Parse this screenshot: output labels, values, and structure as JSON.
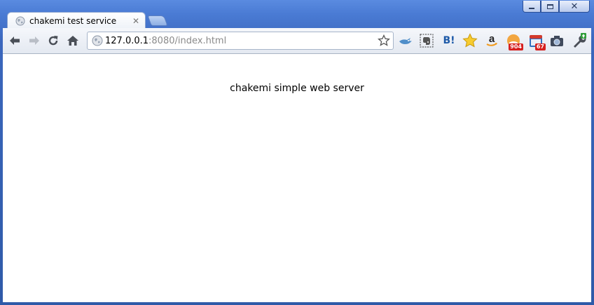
{
  "window": {
    "controls": [
      "minimize",
      "maximize",
      "close"
    ]
  },
  "tabs": [
    {
      "title": "chakemi test service",
      "icon": "globe-icon",
      "active": true
    }
  ],
  "toolbar": {
    "url_host": "127.0.0.1",
    "url_rest": ":8080/index.html",
    "extensions": [
      {
        "name": "bird-icon"
      },
      {
        "name": "evernote-icon"
      },
      {
        "name": "hatena-bookmark-icon",
        "label": "B!"
      },
      {
        "name": "star-bookmark-icon"
      },
      {
        "name": "amazon-icon",
        "label": "a"
      },
      {
        "name": "rss-icon",
        "badge": "904"
      },
      {
        "name": "calendar-icon",
        "badge": "67"
      },
      {
        "name": "camera-icon"
      },
      {
        "name": "wrench-icon"
      }
    ]
  },
  "page": {
    "heading": "chakemi simple web server"
  },
  "colors": {
    "frame": "#3f6fc4",
    "badge": "#d6201f"
  }
}
